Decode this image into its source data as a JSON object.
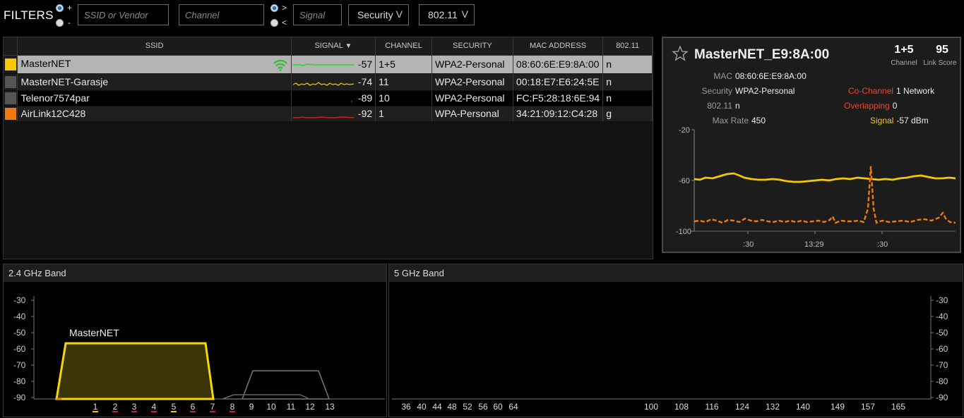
{
  "filters": {
    "title": "FILTERS",
    "plus": "+",
    "minus": "-",
    "gt": ">",
    "lt": "<",
    "ssid_placeholder": "SSID or Vendor",
    "channel_placeholder": "Channel",
    "signal_placeholder": "Signal",
    "security_label": "Security",
    "standard_label": "802.11",
    "chevron": "V"
  },
  "table": {
    "headers": [
      "SSID",
      "SIGNAL",
      "CHANNEL",
      "SECURITY",
      "MAC ADDRESS",
      "802.11"
    ],
    "sort_arrow": "▼",
    "rows": [
      {
        "ssid": "MasterNET",
        "signal": "-57",
        "channel": "1+5",
        "security": "WPA2-Personal",
        "mac": "08:60:6E:E9:8A:00",
        "std": "n",
        "color": "#f5c800",
        "spark_color": "#22dd22",
        "connected": true
      },
      {
        "ssid": "MasterNET-Garasje",
        "signal": "-74",
        "channel": "11",
        "security": "WPA2-Personal",
        "mac": "00:18:E7:E6:24:5E",
        "std": "n",
        "color": "#555555",
        "spark_color": "#e8d000",
        "connected": false
      },
      {
        "ssid": "Telenor7574par",
        "signal": "-89",
        "channel": "10",
        "security": "WPA2-Personal",
        "mac": "FC:F5:28:18:6E:94",
        "std": "n",
        "color": "#555555",
        "spark_color": "#cc2222",
        "connected": false
      },
      {
        "ssid": "AirLink12C428",
        "signal": "-92",
        "channel": "1",
        "security": "WPA-Personal",
        "mac": "34:21:09:12:C4:28",
        "std": "g",
        "color": "#f07a10",
        "spark_color": "#cc2222",
        "connected": false
      }
    ]
  },
  "details": {
    "title": "MasterNET_E9:8A:00",
    "channel": "1+5",
    "channel_label": "Channel",
    "link_score": "95",
    "link_score_label": "Link Score",
    "mac_k": "MAC",
    "mac_v": "08:60:6E:E9:8A:00",
    "security_k": "Security",
    "security_v": "WPA2-Personal",
    "std_k": "802.11",
    "std_v": "n",
    "rate_k": "Max Rate",
    "rate_v": "450",
    "cochannel_k": "Co-Channel",
    "cochannel_v": "1 Network",
    "overlap_k": "Overlapping",
    "overlap_v": "0",
    "signal_k": "Signal",
    "signal_v": "-57 dBm",
    "chart": {
      "y_ticks": [
        "-20",
        "-60",
        "-100"
      ],
      "x_ticks": [
        ":30",
        "13:29",
        ":30"
      ]
    }
  },
  "band24": {
    "title": "2.4 GHz Band",
    "y_ticks": [
      "-30",
      "-40",
      "-50",
      "-60",
      "-70",
      "-80",
      "-90"
    ],
    "channels": [
      "1",
      "2",
      "3",
      "4",
      "5",
      "6",
      "7",
      "8",
      "9",
      "10",
      "11",
      "12",
      "13"
    ],
    "network_label": "MasterNET"
  },
  "band5": {
    "title": "5 GHz Band",
    "y_ticks": [
      "-30",
      "-40",
      "-50",
      "-60",
      "-70",
      "-80",
      "-90"
    ],
    "channels_low": [
      "36",
      "40",
      "44",
      "48",
      "52",
      "56",
      "60",
      "64"
    ],
    "channels_high": [
      "100",
      "108",
      "116",
      "124",
      "132",
      "140",
      "149",
      "157",
      "165"
    ]
  },
  "colors": {
    "accent_yellow": "#f5c800",
    "accent_orange": "#f07a10",
    "signal_green": "#22dd22"
  }
}
